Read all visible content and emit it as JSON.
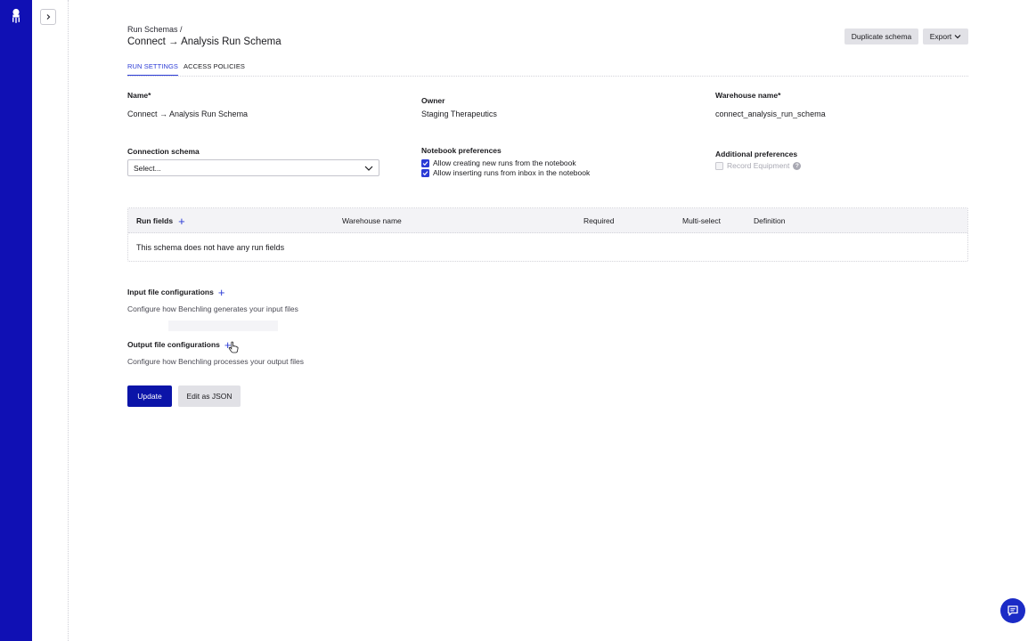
{
  "breadcrumb": "Run Schemas /",
  "page_title": "Connect → Analysis Run Schema",
  "header_buttons": {
    "duplicate": "Duplicate schema",
    "export": "Export"
  },
  "tabs": [
    {
      "label": "RUN SETTINGS",
      "active": true
    },
    {
      "label": "ACCESS POLICIES",
      "active": false
    }
  ],
  "fields": {
    "name_label": "Name*",
    "name_value": "Connect → Analysis Run Schema",
    "owner_label": "Owner",
    "owner_value": "Staging Therapeutics",
    "warehouse_label": "Warehouse name*",
    "warehouse_value": "connect_analysis_run_schema",
    "connection_label": "Connection schema",
    "connection_value": "Select...",
    "notebook_label": "Notebook preferences",
    "notebook_options": [
      {
        "label": "Allow creating new runs from the notebook",
        "checked": true
      },
      {
        "label": "Allow inserting runs from inbox in the notebook",
        "checked": true
      }
    ],
    "additional_label": "Additional preferences",
    "additional_options": [
      {
        "label": "Record Equipment",
        "checked": false,
        "disabled": true
      }
    ]
  },
  "run_fields_table": {
    "columns": [
      "Run fields",
      "Warehouse name",
      "Required",
      "Multi-select",
      "Definition"
    ],
    "empty_message": "This schema does not have any run fields"
  },
  "input_config": {
    "title": "Input file configurations",
    "description": "Configure how Benchling generates your input files"
  },
  "output_config": {
    "title": "Output file configurations",
    "description": "Configure how Benchling processes your output files"
  },
  "actions": {
    "update": "Update",
    "edit_json": "Edit as JSON"
  },
  "colors": {
    "primary": "#0b14a8",
    "accent": "#2b3bd6",
    "sidebar": "#1010b4"
  }
}
